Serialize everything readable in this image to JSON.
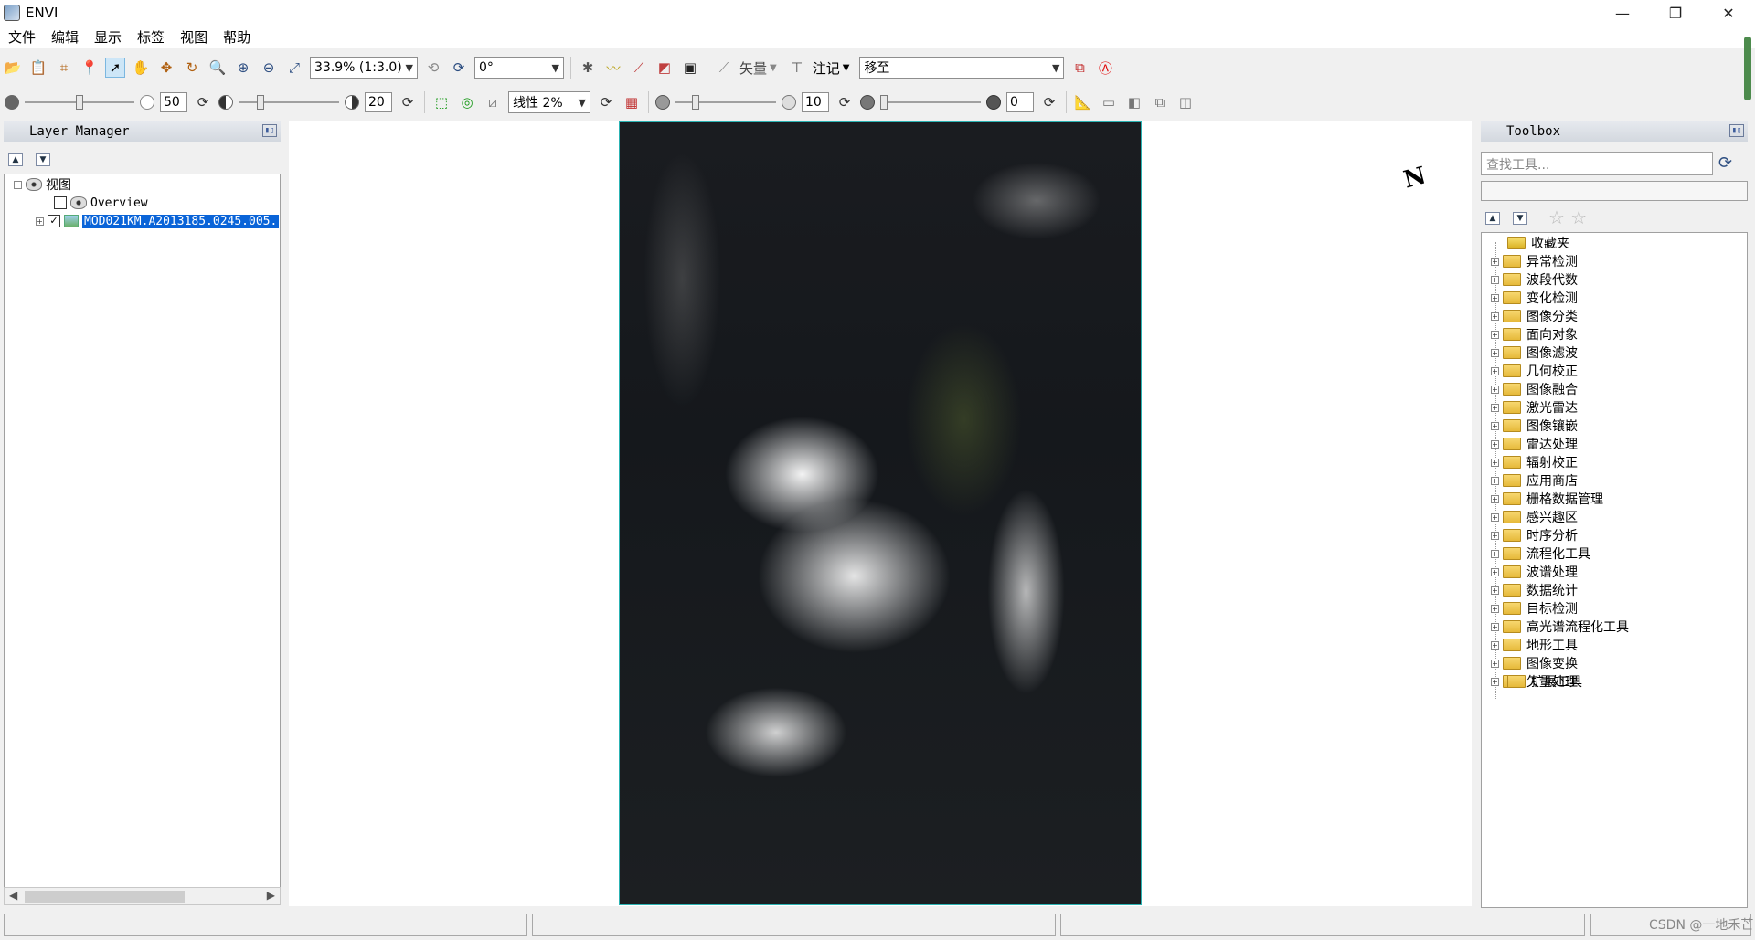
{
  "window": {
    "title": "ENVI",
    "minimize": "—",
    "maximize": "❐",
    "close": "✕"
  },
  "menu": [
    "文件",
    "编辑",
    "显示",
    "标签",
    "视图",
    "帮助"
  ],
  "toolbar1": {
    "zoom_value": "33.9% (1:3.0)",
    "rotation_value": "0°",
    "vector_label": "矢量",
    "annotation_label": "注记",
    "goto_value": "移至"
  },
  "toolbar2": {
    "brightness_value": "50",
    "contrast_value": "20",
    "stretch_value": "线性 2%",
    "sharpen_value": "10",
    "transparency_value": "0"
  },
  "layer_manager": {
    "title": "Layer Manager",
    "root_label": "视图",
    "overview_label": "Overview",
    "layer_label": "MOD021KM.A2013185.0245.005."
  },
  "view": {
    "north_arrow": "N"
  },
  "toolbox": {
    "title": "Toolbox",
    "search_placeholder": "查找工具...",
    "favorites": "收藏夹",
    "folders": [
      "异常检测",
      "波段代数",
      "变化检测",
      "图像分类",
      "面向对象",
      "图像滤波",
      "几何校正",
      "图像融合",
      "激光雷达",
      "图像镶嵌",
      "雷达处理",
      "辐射校正",
      "应用商店",
      "栅格数据管理",
      "感兴趣区",
      "时序分析",
      "流程化工具",
      "波谱处理",
      "数据统计",
      "目标检测",
      "高光谱流程化工具",
      "地形工具",
      "图像变换",
      "矢量处理"
    ],
    "extensions": "扩展工具"
  },
  "status": {
    "watermark": "CSDN @一地禾芒"
  }
}
